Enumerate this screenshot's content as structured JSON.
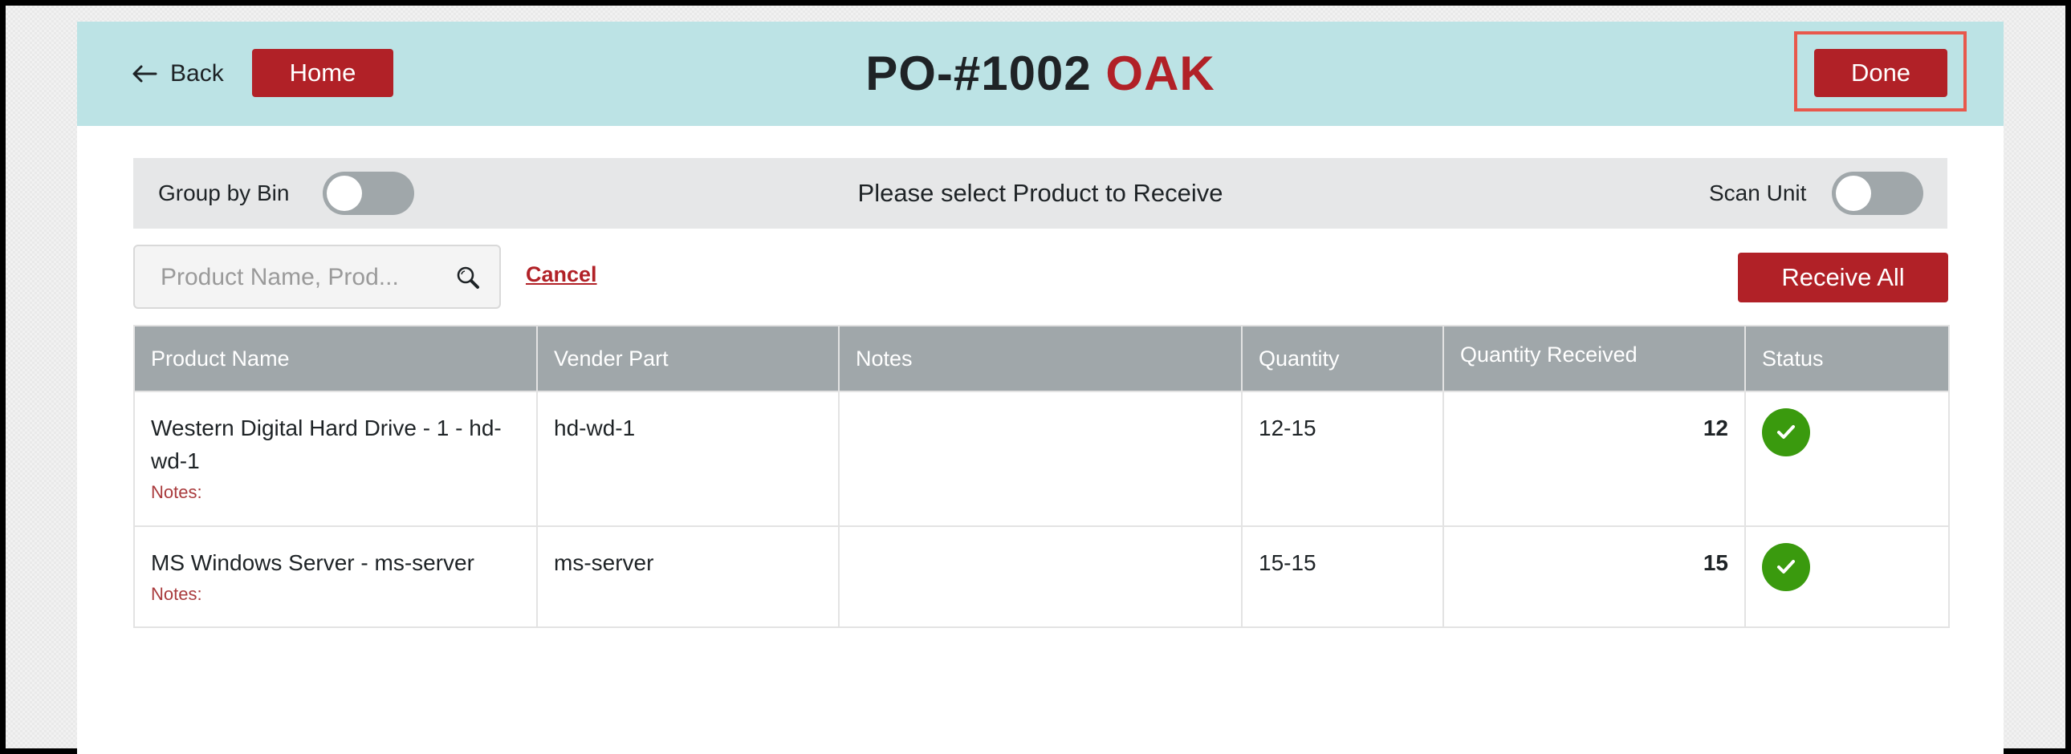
{
  "header": {
    "back_label": "Back",
    "home_label": "Home",
    "title_main": "PO-#1002",
    "title_accent": "OAK",
    "done_label": "Done"
  },
  "toolbar": {
    "group_by_bin_label": "Group by Bin",
    "group_by_bin_on": false,
    "message": "Please select Product to Receive",
    "scan_unit_label": "Scan Unit",
    "scan_unit_on": false
  },
  "search": {
    "placeholder": "Product Name, Prod...",
    "value": "",
    "cancel_label": "Cancel",
    "receive_all_label": "Receive All"
  },
  "table": {
    "columns": [
      "Product Name",
      "Vender Part",
      "Notes",
      "Quantity",
      "Quantity Received",
      "Status"
    ],
    "rows": [
      {
        "product_name": "Western Digital Hard Drive - 1 - hd-wd-1",
        "notes_label": "Notes:",
        "vender_part": "hd-wd-1",
        "notes": "",
        "quantity": "12-15",
        "quantity_received": "12",
        "status": "check-icon"
      },
      {
        "product_name": "MS Windows Server - ms-server",
        "notes_label": "Notes:",
        "vender_part": "ms-server",
        "notes": "",
        "quantity": "15-15",
        "quantity_received": "15",
        "status": "check-icon"
      }
    ]
  },
  "colors": {
    "header_bg": "#bce3e5",
    "accent_red": "#b12127",
    "highlight_border": "#e8584c",
    "table_header_bg": "#a0a7aa",
    "status_ok": "#3a9a0e"
  }
}
